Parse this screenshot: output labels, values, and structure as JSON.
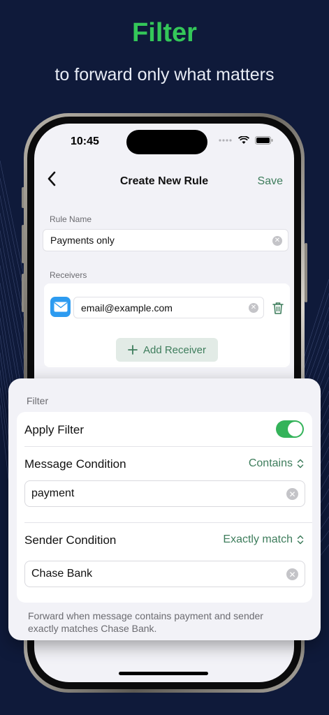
{
  "hero": {
    "title": "Filter",
    "subtitle": "to forward only what matters"
  },
  "status_bar": {
    "time": "10:45"
  },
  "nav": {
    "title": "Create New Rule",
    "save_label": "Save",
    "back_icon": "chevron-left-icon"
  },
  "rule_name": {
    "label": "Rule Name",
    "value": "Payments only"
  },
  "receivers": {
    "label": "Receivers",
    "items": [
      {
        "email": "email@example.com",
        "icon": "mail-icon"
      }
    ],
    "add_label": "Add Receiver"
  },
  "filter": {
    "section_label": "Filter",
    "apply_filter_label": "Apply Filter",
    "apply_filter_on": true,
    "message_condition": {
      "label": "Message Condition",
      "mode": "Contains",
      "value": "payment"
    },
    "sender_condition": {
      "label": "Sender Condition",
      "mode": "Exactly match",
      "value": "Chase Bank"
    },
    "footer": "Forward when message contains payment and sender exactly matches Chase Bank."
  },
  "colors": {
    "accent_green": "#34c759",
    "link_green": "#3e7d5c",
    "background": "#0f1a3a",
    "toggle_on": "#34b35a"
  }
}
